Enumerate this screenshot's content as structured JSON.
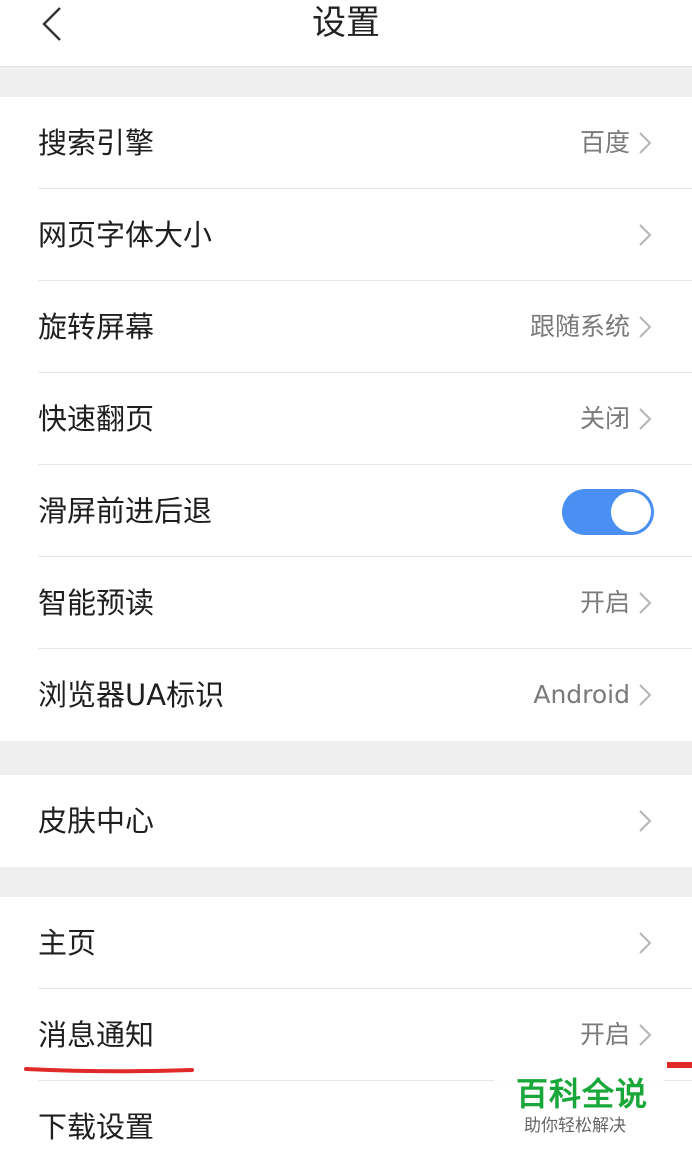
{
  "header": {
    "title": "设置"
  },
  "section1": {
    "items": [
      {
        "label": "搜索引擎",
        "value": "百度"
      },
      {
        "label": "网页字体大小",
        "value": ""
      },
      {
        "label": "旋转屏幕",
        "value": "跟随系统"
      },
      {
        "label": "快速翻页",
        "value": "关闭"
      },
      {
        "label": "滑屏前进后退",
        "toggle_on": true
      },
      {
        "label": "智能预读",
        "value": "开启"
      },
      {
        "label": "浏览器UA标识",
        "value": "Android"
      }
    ]
  },
  "section2": {
    "items": [
      {
        "label": "皮肤中心",
        "value": ""
      }
    ]
  },
  "section3": {
    "items": [
      {
        "label": "主页",
        "value": ""
      },
      {
        "label": "消息通知",
        "value": "开启"
      },
      {
        "label": "下载设置",
        "value": ""
      }
    ]
  },
  "watermark": {
    "title": "百科全说",
    "subtitle": "助你轻松解决"
  },
  "colors": {
    "accent": "#4a8ff2",
    "highlight": "#e02a2a",
    "watermark_green": "#1aa73a"
  },
  "icons": {
    "back": "chevron-left-icon",
    "row_arrow": "chevron-right-icon"
  }
}
